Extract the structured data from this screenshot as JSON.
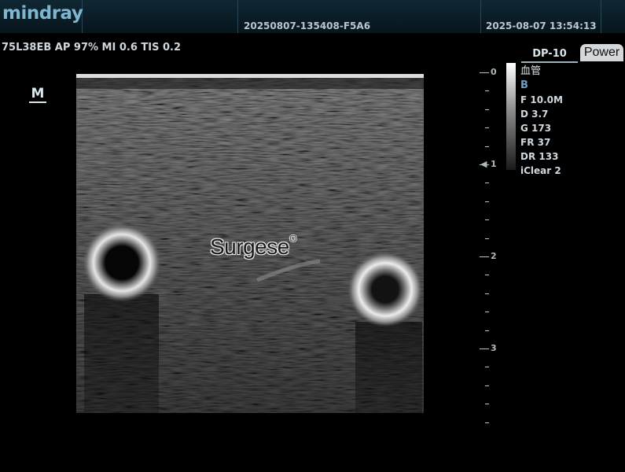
{
  "header": {
    "brand": "mindray",
    "exam_id": "20250807-135408-F5A6",
    "datetime": "2025-08-07 13:54:13"
  },
  "acoustic": {
    "text": "75L38EB  AP 97%  MI 0.6 TIS 0.2"
  },
  "orientation_marker": "M",
  "watermark": {
    "text": "Surgese",
    "symbol": "®"
  },
  "depth_scale": {
    "unit_marks": [
      "0",
      "1",
      "2",
      "3"
    ],
    "focus_depth": 1
  },
  "tabs": {
    "dp": "DP-10",
    "power": "Power"
  },
  "image_info": {
    "preset": "血管",
    "mode": "B",
    "frequency": "F 10.0M",
    "depth": "D 3.7",
    "gain": "G 173",
    "frame_rate": "FR 37",
    "dynamic_range": "DR 133",
    "iclear": "iClear 2"
  },
  "colors": {
    "header_bg": "#0c222c",
    "brand": "#7eb6cf",
    "mode_text": "#6e9ec0",
    "tab_active": "#d4d8da"
  }
}
